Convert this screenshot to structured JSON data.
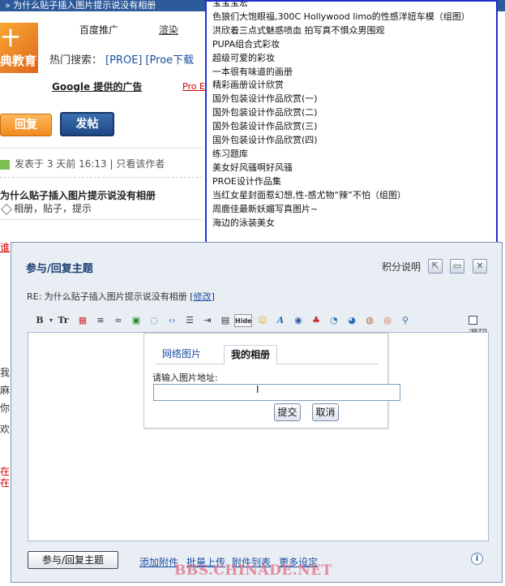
{
  "page": {
    "topbar_title": "» 为什么贴子插入图片提示说没有相册",
    "logo_text_top": "十",
    "logo_text_bottom": "典教育",
    "ad_links": [
      "百度推广",
      "渲染"
    ],
    "hot_search_label": "热门搜索：",
    "hot_search_keywords": [
      "[PROE]",
      "[Proe下载"
    ],
    "google_ads": "Google 提供的广告",
    "proe_link": "Pro E",
    "reply_button": "回复",
    "post_button": "发帖",
    "post_meta": "发表于  3 天前 16:13  |  只看该作者",
    "post_title": "为什么贴子插入图片提示说没有相册",
    "post_tags": "相册，贴子，提示",
    "left_fragments": [
      "我",
      "麻",
      "你",
      "欢",
      "在",
      "在"
    ],
    "red_fragment": "谁"
  },
  "dropdown": {
    "items": [
      "宝宝宝宏",
      "色狼们大饱眼福,300C Hollywood limo的性感洋妞车模（组图）",
      "洪欣着三点式魅惑喷血 拍写真不惧众男围观",
      "PUPA组合式彩妆",
      "超级可爱的彩妆",
      "一本很有味道的画册",
      "精彩画册设计欣赏",
      "国外包装设计作品欣赏(一)",
      "国外包装设计作品欣赏(二)",
      "国外包装设计作品欣赏(三)",
      "国外包装设计作品欣赏(四)",
      "练习题库",
      "美女好风骚啊好风骚",
      "PROE设计作品集",
      "当红女星封面惹幻想,性-感尤物“辣”不怕（组图）",
      "周鹿佳最新妖媚写真图片~",
      "海边的泳装美女"
    ]
  },
  "dialog": {
    "title": "参与/回复主题",
    "score_link": "积分说明",
    "subject_prefix": "RE: 为什么贴子插入图片提示说没有相册 [",
    "subject_modify": "修改",
    "subject_suffix": "]",
    "source_toggle": "源码",
    "toolbar_icons": [
      "bold-icon",
      "font-size-icon",
      "color-icon",
      "align-icon",
      "link-icon",
      "image-icon",
      "quote-icon",
      "code-icon",
      "ordered-list-icon",
      "indent-icon",
      "table-icon",
      "hide-icon",
      "smiley-icon",
      "font-icon",
      "flash-icon",
      "qq-icon",
      "real-icon",
      "media-icon",
      "audio-icon",
      "video-icon",
      "tool-icon"
    ],
    "toolbar_labels": {
      "bold": "B",
      "font_size": "Tr",
      "hide": "Hide",
      "font": "A"
    },
    "image_panel": {
      "tab_web": "网络图片",
      "tab_album": "我的相册",
      "url_label": "请输入图片地址:",
      "url_value": "",
      "submit": "提交",
      "cancel": "取消"
    },
    "footer": {
      "reply_button": "参与/回复主题",
      "links": [
        "添加附件",
        "批量上传",
        "附件列表",
        "更多设定"
      ]
    }
  },
  "watermark": "BBS.CHINADE.NET",
  "colors": {
    "accent": "#1d3f72",
    "dropdown_border": "#1f2fd0",
    "link": "#1b4fa2",
    "reply_orange": "#f0891e",
    "post_blue": "#1e4985"
  }
}
